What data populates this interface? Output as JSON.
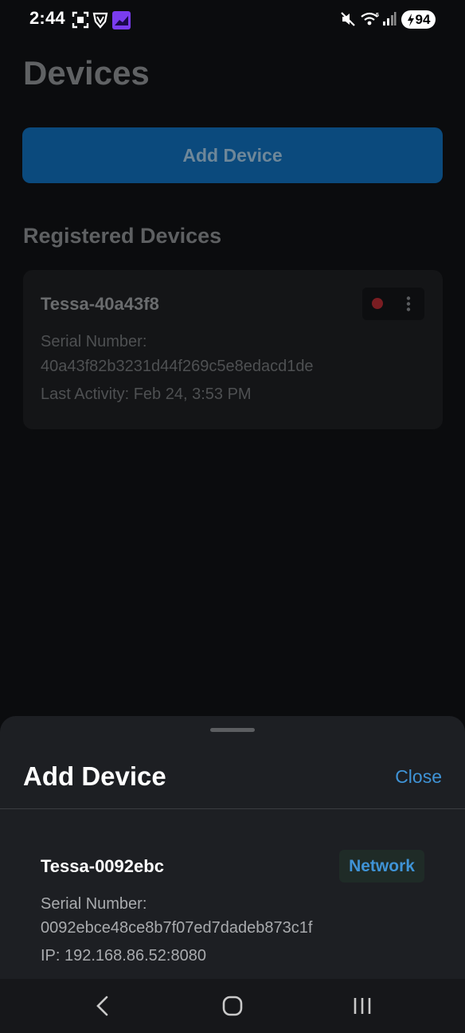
{
  "status_bar": {
    "time": "2:44",
    "battery": "94",
    "icons": [
      "screenshot-icon",
      "vpn-shield-icon",
      "app-notification-icon",
      "mute-icon",
      "wifi-icon",
      "signal-icon",
      "battery-charging-icon"
    ]
  },
  "page": {
    "title": "Devices",
    "add_button_label": "Add Device",
    "section_title": "Registered Devices"
  },
  "registered_devices": [
    {
      "name": "Tessa-40a43f8",
      "serial_label": "Serial Number:",
      "serial": "40a43f82b3231d44f269c5e8edacd1de",
      "last_activity": "Last Activity: Feb 24, 3:53 PM",
      "status_color": "#c62828"
    }
  ],
  "sheet": {
    "title": "Add Device",
    "close_label": "Close",
    "discovered": [
      {
        "name": "Tessa-0092ebc",
        "badge": "Network",
        "serial_label": "Serial Number:",
        "serial": "0092ebce48ce8b7f07ed7dadeb873c1f",
        "ip": "IP: 192.168.86.52:8080"
      }
    ]
  },
  "colors": {
    "accent": "#3f93d6",
    "primary_button": "#0b4a7d",
    "background": "#0b0c0e",
    "sheet": "#1d1f23"
  }
}
